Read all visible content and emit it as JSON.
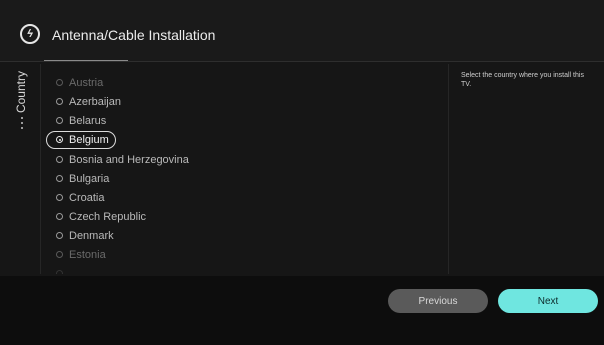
{
  "header": {
    "title": "Antenna/Cable Installation",
    "icon": "installation-icon"
  },
  "sidebar": {
    "tab_label": "Country"
  },
  "country_list": {
    "items": [
      {
        "label": "Austria",
        "state": "dim"
      },
      {
        "label": "Azerbaijan",
        "state": "normal"
      },
      {
        "label": "Belarus",
        "state": "normal"
      },
      {
        "label": "Belgium",
        "state": "selected"
      },
      {
        "label": "Bosnia and Herzegovina",
        "state": "normal"
      },
      {
        "label": "Bulgaria",
        "state": "normal"
      },
      {
        "label": "Croatia",
        "state": "normal"
      },
      {
        "label": "Czech Republic",
        "state": "normal"
      },
      {
        "label": "Denmark",
        "state": "normal"
      },
      {
        "label": "Estonia",
        "state": "dim"
      }
    ],
    "selected": "Belgium"
  },
  "help": {
    "text": "Select the country where you install this TV."
  },
  "buttons": {
    "previous_label": "Previous",
    "next_label": "Next"
  },
  "colors": {
    "accent": "#6fe6e0",
    "background": "#161616"
  }
}
